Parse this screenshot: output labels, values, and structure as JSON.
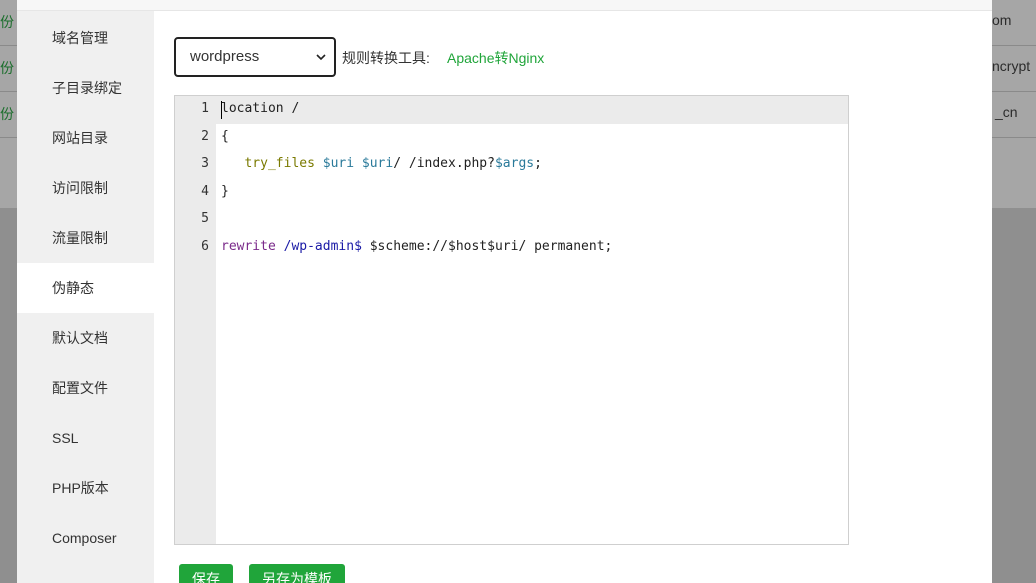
{
  "background": {
    "left_rows": [
      "份",
      "份",
      "份"
    ],
    "right_rows": [
      "om",
      "ncrypt",
      "_cn"
    ]
  },
  "sidebar": {
    "items": [
      {
        "label": "域名管理"
      },
      {
        "label": "子目录绑定"
      },
      {
        "label": "网站目录"
      },
      {
        "label": "访问限制"
      },
      {
        "label": "流量限制"
      },
      {
        "label": "伪静态"
      },
      {
        "label": "默认文档"
      },
      {
        "label": "配置文件"
      },
      {
        "label": "SSL"
      },
      {
        "label": "PHP版本"
      },
      {
        "label": "Composer"
      }
    ],
    "active_index": 5
  },
  "toolbar": {
    "selected_template": "wordpress",
    "tool_label": "规则转换工具:",
    "tool_link": "Apache转Nginx"
  },
  "editor": {
    "line_numbers": [
      "1",
      "2",
      "3",
      "4",
      "5",
      "6"
    ],
    "lines": [
      "location /",
      "{",
      "   try_files $uri $uri/ /index.php?$args;",
      "}",
      "",
      "rewrite /wp-admin$ $scheme://$host$uri/ permanent;"
    ]
  },
  "actions": {
    "save_label": "保存",
    "save_as_template_label": "另存为模板"
  },
  "colors": {
    "accent": "#20a53a",
    "sidebar_bg": "#f0f0f0"
  }
}
